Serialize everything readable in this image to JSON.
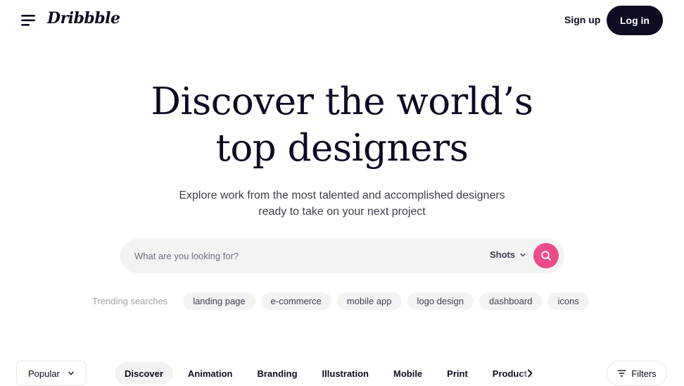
{
  "header": {
    "logo": "Dribbble",
    "signup_label": "Sign up",
    "login_label": "Log in"
  },
  "hero": {
    "title_line1": "Discover the world’s",
    "title_line2": "top designers",
    "subtitle_line1": "Explore work from the most talented and accomplished designers",
    "subtitle_line2": "ready to take on your next project"
  },
  "search": {
    "placeholder": "What are you looking for?",
    "type_selected": "Shots",
    "accent_color": "#ea4c89"
  },
  "trending": {
    "label": "Trending searches",
    "tags": [
      "landing page",
      "e-commerce",
      "mobile app",
      "logo design",
      "dashboard",
      "icons"
    ]
  },
  "filter_bar": {
    "sort_selected": "Popular",
    "categories": [
      "Discover",
      "Animation",
      "Branding",
      "Illustration",
      "Mobile",
      "Print",
      "Product Design"
    ],
    "active_category": "Discover",
    "filters_label": "Filters"
  },
  "icons": {
    "menu": "hamburger-menu-icon",
    "search": "search-icon",
    "chevron": "chevron-down-icon",
    "next": "chevron-right-icon",
    "filters": "filter-lines-icon"
  }
}
